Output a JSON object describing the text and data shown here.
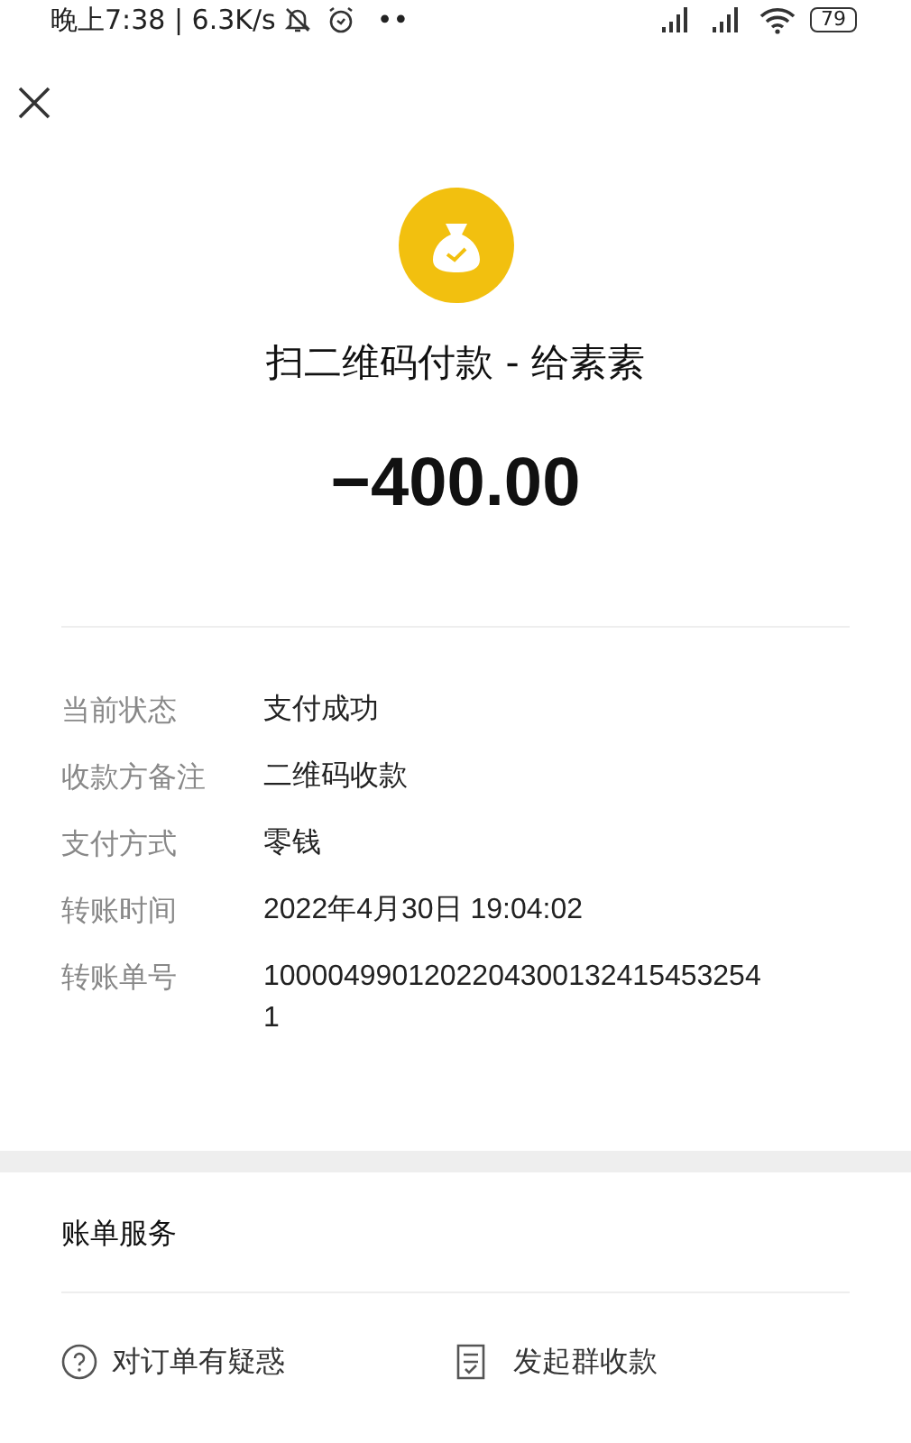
{
  "status_bar": {
    "time": "晚上7:38 | 6.3K/s",
    "dots": "••",
    "battery": "79"
  },
  "header": {
    "title": "扫二维码付款 - 给素素",
    "amount": "−400.00"
  },
  "details": [
    {
      "label": "当前状态",
      "value": "支付成功"
    },
    {
      "label": "收款方备注",
      "value": "二维码收款"
    },
    {
      "label": "支付方式",
      "value": "零钱"
    },
    {
      "label": "转账时间",
      "value": "2022年4月30日 19:04:02"
    },
    {
      "label": "转账单号",
      "value": "10000499012022043001324154532541"
    }
  ],
  "services": {
    "title": "账单服务",
    "items": [
      {
        "kind": "question",
        "label": "对订单有疑惑"
      },
      {
        "kind": "document",
        "label": "发起群收款"
      }
    ]
  }
}
